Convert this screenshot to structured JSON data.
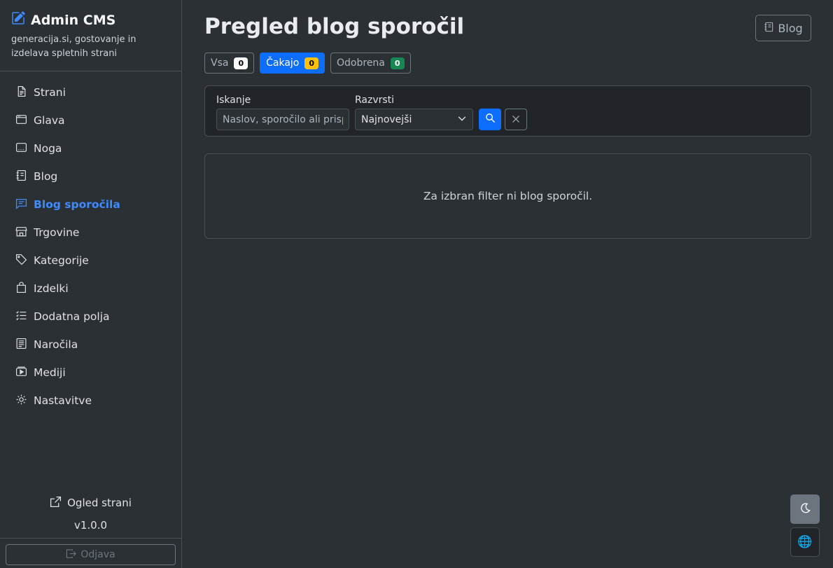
{
  "brand": {
    "title": "Admin CMS",
    "subtitle": "generacija.si, gostovanje in izdelava spletnih strani"
  },
  "sidebar": {
    "items": [
      {
        "label": "Strani",
        "icon": "file-text-icon",
        "active": false
      },
      {
        "label": "Glava",
        "icon": "window-header-icon",
        "active": false
      },
      {
        "label": "Noga",
        "icon": "window-footer-icon",
        "active": false
      },
      {
        "label": "Blog",
        "icon": "journal-icon",
        "active": false
      },
      {
        "label": "Blog sporočila",
        "icon": "chat-lines-icon",
        "active": true
      },
      {
        "label": "Trgovine",
        "icon": "shop-icon",
        "active": false
      },
      {
        "label": "Kategorije",
        "icon": "tags-icon",
        "active": false
      },
      {
        "label": "Izdelki",
        "icon": "bag-icon",
        "active": false
      },
      {
        "label": "Dodatna polja",
        "icon": "list-check-icon",
        "active": false
      },
      {
        "label": "Naročila",
        "icon": "receipt-icon",
        "active": false
      },
      {
        "label": "Mediji",
        "icon": "play-media-icon",
        "active": false
      },
      {
        "label": "Nastavitve",
        "icon": "gear-icon",
        "active": false
      }
    ],
    "view_site_label": "Ogled strani",
    "version": "v1.0.0",
    "logout_label": "Odjava"
  },
  "main": {
    "title": "Pregled blog sporočil",
    "blog_button_label": "Blog",
    "tabs": [
      {
        "label": "Vsa",
        "count": "0",
        "badge_color": "#ffffff",
        "active": false
      },
      {
        "label": "Čakajo",
        "count": "0",
        "badge_color": "#ffc107",
        "active": true
      },
      {
        "label": "Odobrena",
        "count": "0",
        "badge_color": "#198754",
        "active": false
      }
    ],
    "filter": {
      "search_label": "Iskanje",
      "search_placeholder": "Naslov, sporočilo ali prispevek",
      "sort_label": "Razvrsti",
      "sort_value": "Najnovejši"
    },
    "empty_message": "Za izbran filter ni blog sporočil."
  },
  "colors": {
    "accent": "#0d6efd",
    "active_nav": "#3d8bfd",
    "background": "#2b3035",
    "card": "#212529"
  }
}
